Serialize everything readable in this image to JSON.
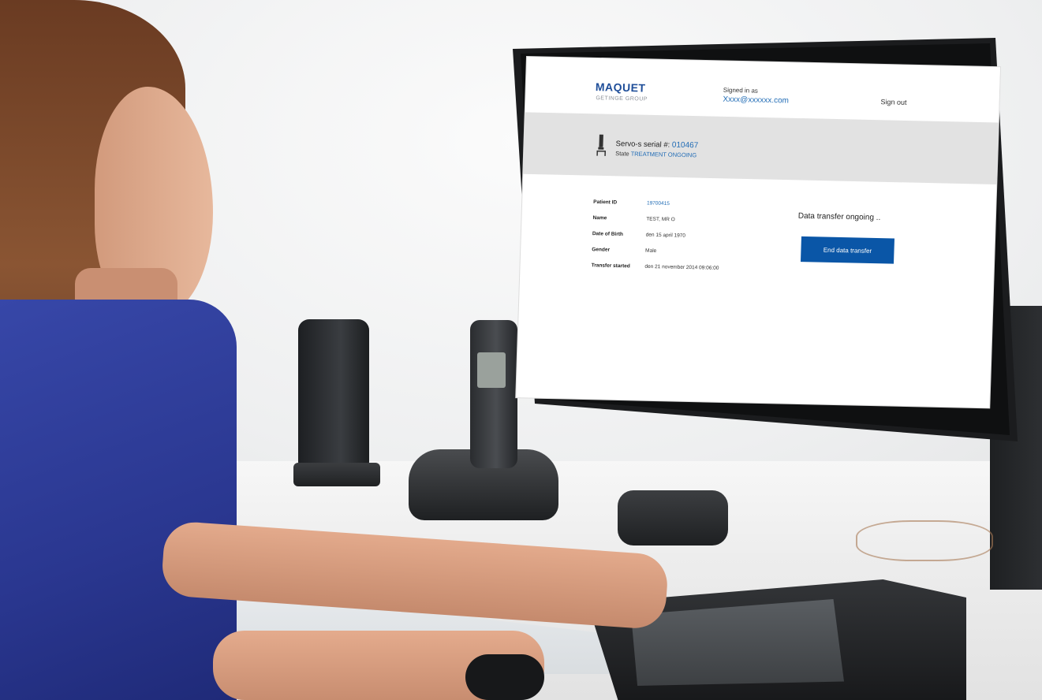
{
  "header": {
    "logo": "MAQUET",
    "logo_sub": "GETINGE GROUP",
    "signed_in_label": "Signed in as",
    "signed_in_user": "Xxxx@xxxxxx.com",
    "sign_out": "Sign out"
  },
  "device": {
    "serial_label": "Servo-s serial #:",
    "serial_value": "010467",
    "state_label": "State",
    "state_value": "TREATMENT ONGOING"
  },
  "patient": {
    "rows": [
      {
        "label": "Patient ID",
        "value": "19700415"
      },
      {
        "label": "Name",
        "value": "TEST, MR O"
      },
      {
        "label": "Date of Birth",
        "value": "den 15 april 1970"
      },
      {
        "label": "Gender",
        "value": "Male"
      },
      {
        "label": "Transfer started",
        "value": "den 21 november 2014 09:06:00"
      }
    ]
  },
  "transfer": {
    "status": "Data transfer ongoing ..",
    "end_button": "End data transfer"
  },
  "colors": {
    "brand": "#1f4e99",
    "link": "#1f6bb5",
    "button": "#0a56a7",
    "device_bar": "#e2e2e2"
  }
}
